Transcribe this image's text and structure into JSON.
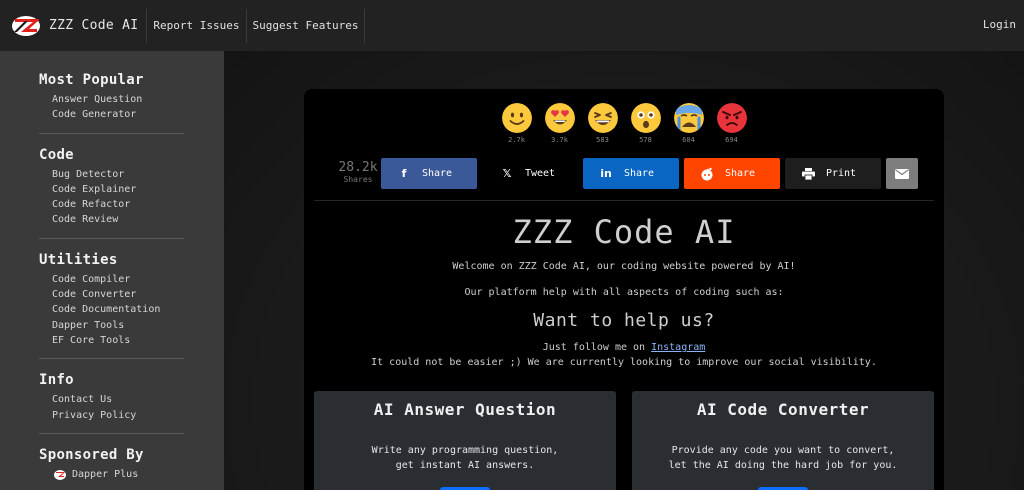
{
  "nav": {
    "brand": "ZZZ Code AI",
    "links": [
      "Report Issues",
      "Suggest Features"
    ],
    "login": "Login"
  },
  "sidebar": {
    "sections": [
      {
        "title": "Most Popular",
        "items": [
          "Answer Question",
          "Code Generator"
        ]
      },
      {
        "title": "Code",
        "items": [
          "Bug Detector",
          "Code Explainer",
          "Code Refactor",
          "Code Review"
        ]
      },
      {
        "title": "Utilities",
        "items": [
          "Code Compiler",
          "Code Converter",
          "Code Documentation",
          "Dapper Tools",
          "EF Core Tools"
        ]
      },
      {
        "title": "Info",
        "items": [
          "Contact Us",
          "Privacy Policy"
        ]
      }
    ],
    "sponsor": {
      "title": "Sponsored By",
      "item": "Dapper Plus"
    }
  },
  "reactions": [
    {
      "icon": "smile-emoji-icon",
      "count": "2.7k"
    },
    {
      "icon": "heart-eyes-emoji-icon",
      "count": "3.7k"
    },
    {
      "icon": "laughing-emoji-icon",
      "count": "583"
    },
    {
      "icon": "surprised-emoji-icon",
      "count": "578"
    },
    {
      "icon": "crying-emoji-icon",
      "count": "604"
    },
    {
      "icon": "angry-emoji-icon",
      "count": "694"
    }
  ],
  "share": {
    "total": "28.2k",
    "total_label": "Shares",
    "buttons": [
      {
        "icon": "facebook-icon",
        "label": "Share",
        "color": "#3b5998"
      },
      {
        "icon": "x-twitter-icon",
        "label": "Tweet",
        "color": "#000000"
      },
      {
        "icon": "linkedin-icon",
        "label": "Share",
        "color": "#0a66c2"
      },
      {
        "icon": "reddit-icon",
        "label": "Share",
        "color": "#ff4500"
      },
      {
        "icon": "print-icon",
        "label": "Print",
        "color": "#1e1e1e"
      },
      {
        "icon": "email-icon",
        "label": "",
        "color": "#7d7d7d"
      }
    ]
  },
  "hero": {
    "title": "ZZZ Code AI",
    "welcome": "Welcome on ZZZ Code AI, our coding website powered by AI!",
    "platform": "Our platform help with all aspects of coding such as:",
    "help_title": "Want to help us?",
    "follow_prefix": "Just follow me on ",
    "follow_link": "Instagram",
    "easier": "It could not be easier ;) We are currently looking to improve our social visibility."
  },
  "tools": [
    {
      "title": "AI Answer Question",
      "desc1": "Write any programming question,",
      "desc2": "get instant AI answers."
    },
    {
      "title": "AI Code Converter",
      "desc1": "Provide any code you want to convert,",
      "desc2": "let the AI doing the hard job for you."
    }
  ],
  "colors": {
    "accent": "#0d6efd",
    "link": "#8ab4f8",
    "brand_red": "#e0211d"
  }
}
